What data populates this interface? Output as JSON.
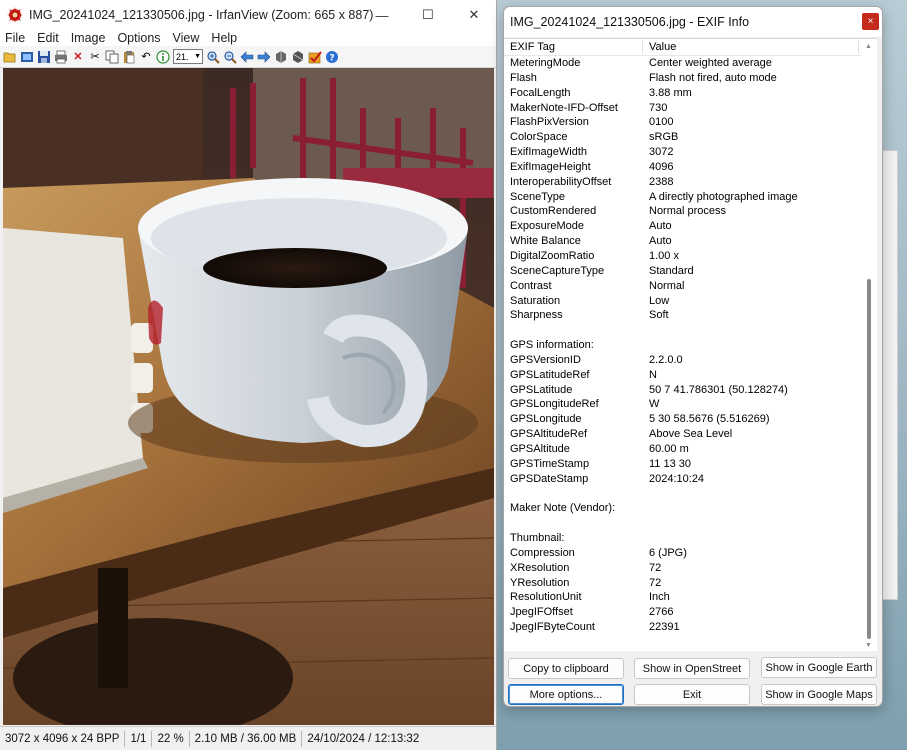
{
  "irfanview": {
    "title": "IMG_20241024_121330506.jpg - IrfanView (Zoom: 665 x 887)",
    "caption_buttons": {
      "minimize": "—",
      "maximize": "☐",
      "close": "✕"
    },
    "menu": [
      "File",
      "Edit",
      "Image",
      "Options",
      "View",
      "Help"
    ],
    "toolbar": {
      "zoom_value": "21."
    },
    "statusbar": {
      "dimensions": "3072 x 4096 x 24 BPP",
      "page": "1/1",
      "zoom": "22 %",
      "size": "2.10 MB / 36.00 MB",
      "datetime": "24/10/2024 / 12:13:32"
    }
  },
  "exif_window": {
    "title": "IMG_20241024_121330506.jpg - EXIF Info",
    "close_glyph": "×",
    "columns": {
      "tag": "EXIF Tag",
      "value": "Value"
    },
    "rows": [
      [
        "MeteringMode",
        "Center weighted average"
      ],
      [
        "Flash",
        "Flash not fired, auto mode"
      ],
      [
        "FocalLength",
        "3.88 mm"
      ],
      [
        "MakerNote-IFD-Offset",
        "730"
      ],
      [
        "FlashPixVersion",
        "0100"
      ],
      [
        "ColorSpace",
        "sRGB"
      ],
      [
        "ExifImageWidth",
        "3072"
      ],
      [
        "ExifImageHeight",
        "4096"
      ],
      [
        "InteroperabilityOffset",
        "2388"
      ],
      [
        "SceneType",
        "A directly photographed image"
      ],
      [
        "CustomRendered",
        "Normal process"
      ],
      [
        "ExposureMode",
        "Auto"
      ],
      [
        "White Balance",
        "Auto"
      ],
      [
        "DigitalZoomRatio",
        "1.00 x"
      ],
      [
        "SceneCaptureType",
        "Standard"
      ],
      [
        "Contrast",
        "Normal"
      ],
      [
        "Saturation",
        "Low"
      ],
      [
        "Sharpness",
        "Soft"
      ],
      [
        "",
        ""
      ],
      [
        "GPS information:",
        ""
      ],
      [
        "GPSVersionID",
        "2.2.0.0"
      ],
      [
        "GPSLatitudeRef",
        "N"
      ],
      [
        "GPSLatitude",
        "50  7 41.786301 (50.128274)"
      ],
      [
        "GPSLongitudeRef",
        "W"
      ],
      [
        "GPSLongitude",
        "5  30 58.5676 (5.516269)"
      ],
      [
        "GPSAltitudeRef",
        "Above Sea Level"
      ],
      [
        "GPSAltitude",
        "60.00 m"
      ],
      [
        "GPSTimeStamp",
        "11  13  30"
      ],
      [
        "GPSDateStamp",
        "2024:10:24"
      ],
      [
        "",
        ""
      ],
      [
        "Maker Note (Vendor):",
        ""
      ],
      [
        "",
        ""
      ],
      [
        "Thumbnail:",
        ""
      ],
      [
        "Compression",
        "6 (JPG)"
      ],
      [
        "XResolution",
        "72"
      ],
      [
        "YResolution",
        "72"
      ],
      [
        "ResolutionUnit",
        "Inch"
      ],
      [
        "JpegIFOffset",
        "2766"
      ],
      [
        "JpegIFByteCount",
        "22391"
      ]
    ],
    "buttons": {
      "copy": "Copy to clipboard",
      "openstreet": "Show in OpenStreet",
      "google_earth": "Show in Google Earth",
      "more": "More options...",
      "exit": "Exit",
      "google_maps": "Show in Google Maps"
    }
  },
  "colors": {
    "exif_close": "#c42b1c",
    "primary_button_border": "#1f6fbf",
    "desktop_bg": "#9fb6c2"
  }
}
